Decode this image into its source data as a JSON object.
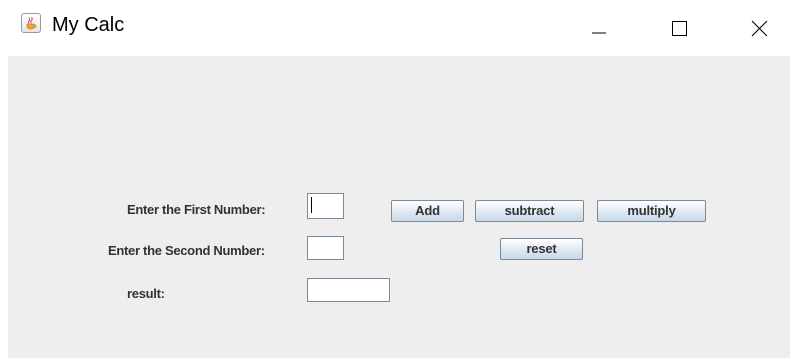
{
  "window": {
    "title": "My Calc",
    "icon": "java-cup-icon",
    "controls": {
      "minimize_icon": "minimize-icon",
      "maximize_icon": "maximize-icon",
      "close_icon": "close-icon"
    }
  },
  "form": {
    "first_label": "Enter the First Number:",
    "first_value": "",
    "second_label": "Enter the Second Number:",
    "second_value": "",
    "result_label": "result:",
    "result_value": ""
  },
  "buttons": {
    "add": "Add",
    "subtract": "subtract",
    "multiply": "multiply",
    "reset": "reset"
  },
  "colors": {
    "panel_background": "#eeeeee",
    "button_border": "#7a8a99",
    "label_text": "#333333"
  }
}
